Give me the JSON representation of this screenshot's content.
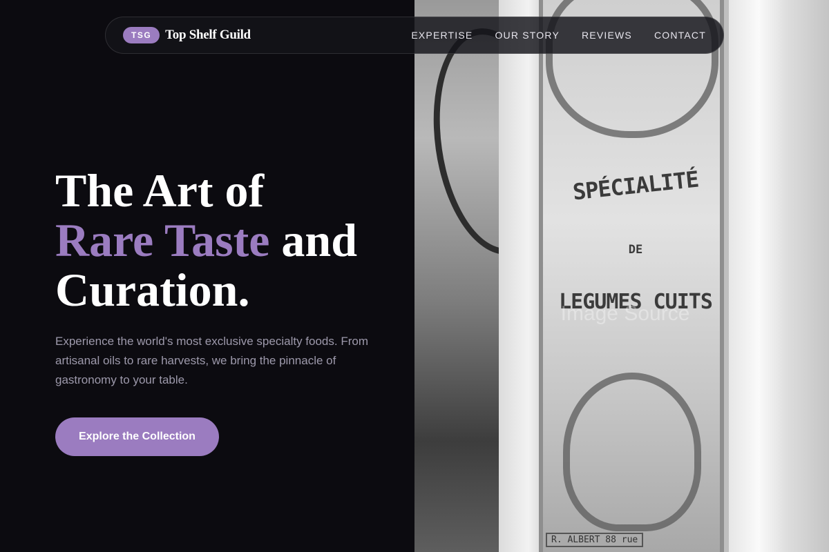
{
  "nav": {
    "badge": "TSG",
    "brand_name": "Top Shelf Guild",
    "links": [
      "EXPERTISE",
      "OUR STORY",
      "REVIEWS",
      "CONTACT"
    ]
  },
  "hero": {
    "title_line1": "The Art of",
    "title_accent": "Rare Taste",
    "title_after_accent": " and",
    "title_line3": "Curation.",
    "description": "Experience the world's most exclusive specialty foods. From artisanal oils to rare harvests, we bring the pinnacle of gastronomy to your table.",
    "cta_label": "Explore the Collection"
  },
  "image": {
    "sign_line1": "SPÉCIALITÉ",
    "sign_line2": "DE",
    "sign_line3": "LEGUMES CUITS",
    "watermark": "Image Source",
    "sign_footer": "R. ALBERT 88 rue"
  },
  "colors": {
    "background": "#0c0b10",
    "accent": "#9b7cc0",
    "muted_text": "#9d99ab"
  }
}
